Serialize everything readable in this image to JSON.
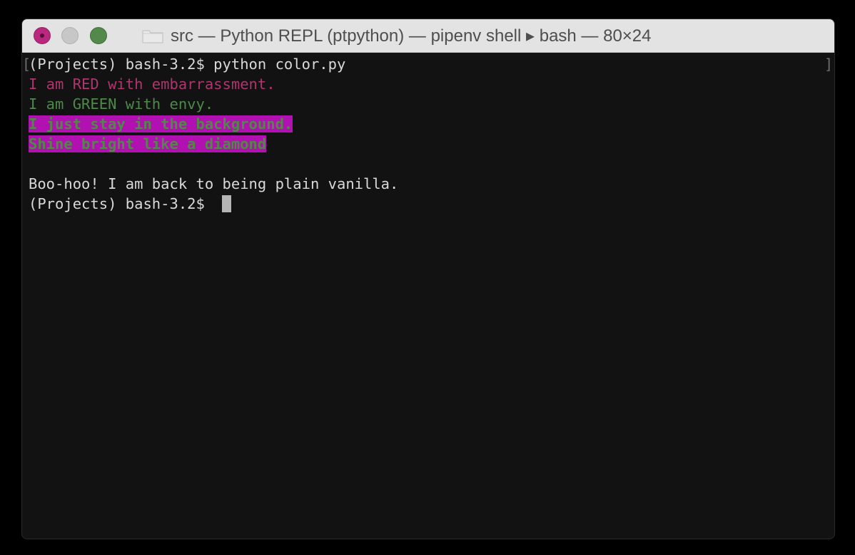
{
  "window": {
    "title": "src — Python REPL (ptpython) — pipenv shell ▸ bash — 80×24"
  },
  "icons": {
    "close": "close-button-icon",
    "minimize": "minimize-button-icon",
    "zoom": "zoom-button-icon",
    "folder": "folder-icon"
  },
  "colors": {
    "red_text": "#b0356f",
    "green_text": "#4d8a4a",
    "highlight_background": "#b011b0",
    "terminal_background": "#121212",
    "default_text": "#d9d9d9"
  },
  "terminal": {
    "bracket_left": "[",
    "bracket_right": "]",
    "lines": [
      "(Projects) bash-3.2$ python color.py",
      "I am RED with embarrassment.",
      "I am GREEN with envy.",
      "I just stay in the background.",
      "Shine bright like a diamond",
      "",
      "Boo-hoo! I am back to being plain vanilla.",
      "(Projects) bash-3.2$ "
    ]
  }
}
